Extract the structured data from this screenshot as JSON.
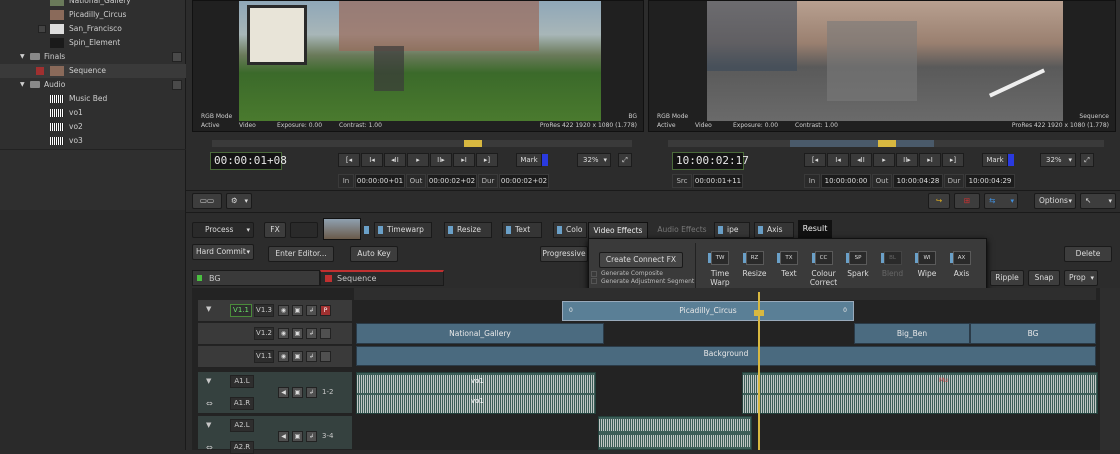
{
  "library": {
    "items": [
      {
        "label": "National_Gallery",
        "kind": "clip"
      },
      {
        "label": "Picadilly_Circus",
        "kind": "clip"
      },
      {
        "label": "San_Francisco",
        "kind": "clip"
      },
      {
        "label": "Spin_Element",
        "kind": "clip"
      },
      {
        "label": "Finals",
        "kind": "folder"
      },
      {
        "label": "Sequence",
        "kind": "clip"
      },
      {
        "label": "Audio",
        "kind": "folder"
      },
      {
        "label": "Music Bed",
        "kind": "audio"
      },
      {
        "label": "vo1",
        "kind": "audio"
      },
      {
        "label": "vo2",
        "kind": "audio"
      },
      {
        "label": "vo3",
        "kind": "audio"
      }
    ]
  },
  "source_viewer": {
    "mode": "RGB Mode",
    "state": "Active",
    "channel": "Video",
    "exposure": "Exposure: 0.00",
    "contrast": "Contrast: 1.00",
    "clip_name": "BG",
    "format": "ProRes 422 1920 x 1080 (1.778)",
    "timecode": "00:00:01+08",
    "mark_label": "Mark",
    "zoom": "32%",
    "in_label": "In",
    "in_value": "00:00:00+01",
    "out_label": "Out",
    "out_value": "00:00:02+02",
    "dur_label": "Dur",
    "dur_value": "00:00:02+02"
  },
  "record_viewer": {
    "mode": "RGB Mode",
    "state": "Active",
    "channel": "Video",
    "exposure": "Exposure: 0.00",
    "contrast": "Contrast: 1.00",
    "clip_name": "Sequence",
    "format": "ProRes 422 1920 x 1080 (1.778)",
    "timecode": "10:00:02:17",
    "mark_label": "Mark",
    "zoom": "32%",
    "src_label": "Src",
    "src_value": "00:00:01+11",
    "in_label": "In",
    "in_value": "10:00:00:00",
    "out_label": "Out",
    "out_value": "10:00:04:28",
    "dur_label": "Dur",
    "dur_value": "10:00:04:29"
  },
  "toolbar": {
    "options_label": "Options",
    "process_label": "Process",
    "fx_label": "FX",
    "hard_commit_label": "Hard Commit",
    "enter_editor_label": "Enter Editor...",
    "auto_key_label": "Auto Key",
    "progressive_label": "Progressive",
    "delete_label": "Delete",
    "ripple_label": "Ripple",
    "snap_label": "Snap",
    "prop_label": "Prop"
  },
  "fx_strip": {
    "chips": [
      "Timewarp",
      "Resize",
      "Text",
      "Colo",
      "ipe",
      "Axis"
    ],
    "result_label": "Result"
  },
  "popup": {
    "tab_video": "Video Effects",
    "tab_audio": "Audio Effects",
    "create_label": "Create Connect FX",
    "option1": "Generate Composite",
    "option2": "Generate Adjustment Segment",
    "effects": [
      {
        "code": "TW",
        "name": "Time Warp",
        "enabled": true
      },
      {
        "code": "RZ",
        "name": "Resize",
        "enabled": true
      },
      {
        "code": "TX",
        "name": "Text",
        "enabled": true
      },
      {
        "code": "CC",
        "name": "Colour Correct",
        "enabled": true
      },
      {
        "code": "SP",
        "name": "Spark",
        "enabled": true
      },
      {
        "code": "BL",
        "name": "Blend",
        "enabled": false
      },
      {
        "code": "WI",
        "name": "Wipe",
        "enabled": true
      },
      {
        "code": "AX",
        "name": "Axis",
        "enabled": true
      }
    ]
  },
  "timeline": {
    "tabs": [
      "BG",
      "Sequence"
    ],
    "video_tracks": [
      {
        "label": "V1.1",
        "sub": "V1.3",
        "patch": "P"
      },
      {
        "label": "V1.2"
      },
      {
        "label": "V1.1"
      }
    ],
    "audio_tracks": [
      {
        "left": "A1.L",
        "right": "A1.R",
        "pair": "1-2"
      },
      {
        "left": "A2.L",
        "right": "A2.R",
        "pair": "3-4"
      }
    ],
    "clips": {
      "top_clip": "Picadilly_Circus",
      "top_clip_in": "0",
      "top_clip_out": "0",
      "v12_clip1": "National_Gallery",
      "v12_clip2": "Big_Ben",
      "v12_clip3": "BG",
      "v11_clip": "Background",
      "a1_clip1": "vo1",
      "a1_clip2": "vo1",
      "a1_clip3_label": "Mu"
    }
  }
}
